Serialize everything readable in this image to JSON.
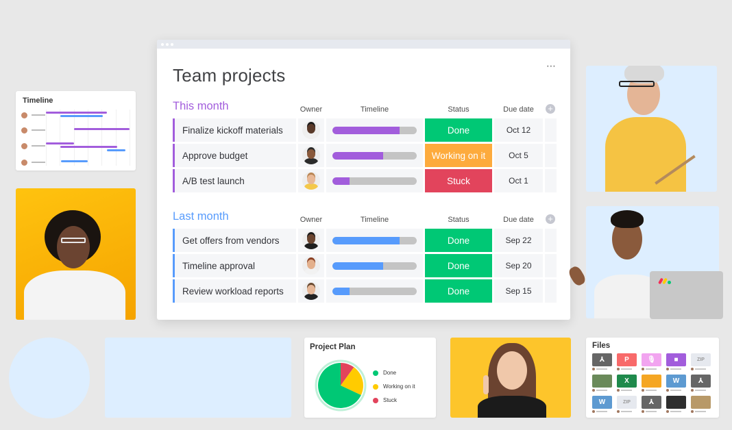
{
  "board": {
    "title": "Team projects",
    "more_icon": "⋯",
    "add_column_icon": "+",
    "columns": {
      "owner": "Owner",
      "timeline": "Timeline",
      "status": "Status",
      "due_date": "Due date"
    },
    "groups": [
      {
        "title": "This month",
        "color": "#a25ddc",
        "rows": [
          {
            "name": "Finalize kickoff materials",
            "progress": 0.8,
            "status": "Done",
            "status_color": "#00c875",
            "due": "Oct 12",
            "owner_skin": "#5a3a2a",
            "owner_hair": "#1b1b1b",
            "owner_shirt": "#f0f0f0"
          },
          {
            "name": "Approve budget",
            "progress": 0.6,
            "status": "Working on it",
            "status_color": "#fdab3d",
            "due": "Oct 5",
            "owner_skin": "#8a5a3c",
            "owner_hair": "#2b2b2b",
            "owner_shirt": "#2b2b2b"
          },
          {
            "name": "A/B test launch",
            "progress": 0.2,
            "status": "Stuck",
            "status_color": "#e2445c",
            "due": "Oct 1",
            "owner_skin": "#e8b896",
            "owner_hair": "#b98553",
            "owner_shirt": "#f4c84a"
          }
        ]
      },
      {
        "title": "Last month",
        "color": "#579bfc",
        "rows": [
          {
            "name": "Get offers from vendors",
            "progress": 0.8,
            "status": "Done",
            "status_color": "#00c875",
            "due": "Sep 22",
            "owner_skin": "#6b4530",
            "owner_hair": "#1b1b1b",
            "owner_shirt": "#1e1e1e"
          },
          {
            "name": "Timeline approval",
            "progress": 0.6,
            "status": "Done",
            "status_color": "#00c875",
            "due": "Sep 20",
            "owner_skin": "#e3b08c",
            "owner_hair": "#8a3f22",
            "owner_shirt": "#f2f2f2"
          },
          {
            "name": "Review workload reports",
            "progress": 0.2,
            "status": "Done",
            "status_color": "#00c875",
            "due": "Sep 15",
            "owner_skin": "#e6b797",
            "owner_hair": "#6a4a30",
            "owner_shirt": "#222222"
          }
        ]
      }
    ]
  },
  "timeline_widget": {
    "title": "Timeline",
    "people": [
      {
        "bars": [
          {
            "start": 0.0,
            "end": 0.73,
            "color": "#a25ddc"
          },
          {
            "start": 0.17,
            "end": 0.68,
            "color": "#579bfc"
          }
        ]
      },
      {
        "bars": [
          {
            "start": 0.34,
            "end": 1.0,
            "color": "#a25ddc"
          }
        ]
      },
      {
        "bars": [
          {
            "start": 0.0,
            "end": 0.34,
            "color": "#a25ddc"
          },
          {
            "start": 0.17,
            "end": 0.85,
            "color": "#a25ddc"
          },
          {
            "start": 0.73,
            "end": 0.95,
            "color": "#579bfc"
          }
        ]
      },
      {
        "bars": [
          {
            "start": 0.18,
            "end": 0.5,
            "color": "#579bfc"
          }
        ]
      }
    ]
  },
  "project_plan": {
    "title": "Project Plan",
    "slices": [
      {
        "label": "Done",
        "value": 68,
        "color": "#00c875"
      },
      {
        "label": "Working on it",
        "value": 22,
        "color": "#ffcb00"
      },
      {
        "label": "Stuck",
        "value": 10,
        "color": "#e2445c"
      }
    ]
  },
  "files_widget": {
    "title": "Files",
    "files": [
      {
        "icon": "pdf-icon",
        "glyph": "⅄",
        "color": "#666666"
      },
      {
        "icon": "powerpoint-icon",
        "glyph": "P",
        "color": "#f86a6a"
      },
      {
        "icon": "audio-icon",
        "glyph": "🎙",
        "color": "#f2a4f0"
      },
      {
        "icon": "video-icon",
        "glyph": "■",
        "color": "#a25ddc"
      },
      {
        "icon": "zip-icon",
        "glyph": "ZIP",
        "color": "#e6e9ef"
      },
      {
        "icon": "image-icon",
        "glyph": "",
        "color": "#6a8a5a"
      },
      {
        "icon": "excel-icon",
        "glyph": "X",
        "color": "#1f8a4c"
      },
      {
        "icon": "image-icon",
        "glyph": "",
        "color": "#f5a623"
      },
      {
        "icon": "word-icon",
        "glyph": "W",
        "color": "#5d9ad1"
      },
      {
        "icon": "pdf-icon",
        "glyph": "⅄",
        "color": "#666666"
      },
      {
        "icon": "word-icon",
        "glyph": "W",
        "color": "#5d9ad1"
      },
      {
        "icon": "zip-icon",
        "glyph": "ZIP",
        "color": "#e6e9ef"
      },
      {
        "icon": "pdf-icon",
        "glyph": "⅄",
        "color": "#666666"
      },
      {
        "icon": "image-icon",
        "glyph": "",
        "color": "#2e2e2e"
      },
      {
        "icon": "image-icon",
        "glyph": "",
        "color": "#b89968"
      }
    ]
  }
}
